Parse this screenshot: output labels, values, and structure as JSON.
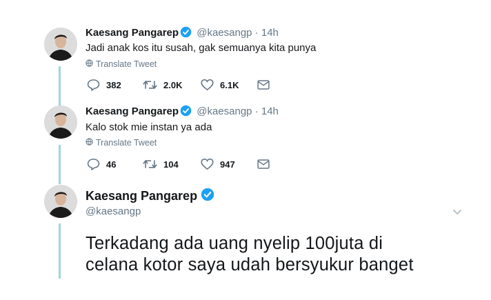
{
  "colors": {
    "brand_blue": "#1da1f2",
    "muted": "#657786",
    "thread": "#9fd5de"
  },
  "icons": [
    "verified-badge",
    "globe-icon",
    "reply-icon",
    "retweet-icon",
    "like-icon",
    "dm-icon",
    "chevron-down-icon"
  ],
  "tweets": [
    {
      "name": "Kaesang Pangarep",
      "handle": "@kaesangp",
      "dot": "·",
      "time": "14h",
      "text": "Jadi anak kos itu susah, gak semuanya kita punya",
      "translate": "Translate Tweet",
      "replies": "382",
      "retweets": "2.0K",
      "likes": "6.1K"
    },
    {
      "name": "Kaesang Pangarep",
      "handle": "@kaesangp",
      "dot": "·",
      "time": "14h",
      "text": "Kalo stok mie instan ya ada",
      "translate": "Translate Tweet",
      "replies": "46",
      "retweets": "104",
      "likes": "947"
    }
  ],
  "focused_tweet": {
    "name": "Kaesang Pangarep",
    "handle": "@kaesangp",
    "line1": "Terkadang ada uang nyelip 100juta di",
    "line2": "celana kotor saya udah bersyukur banget"
  }
}
